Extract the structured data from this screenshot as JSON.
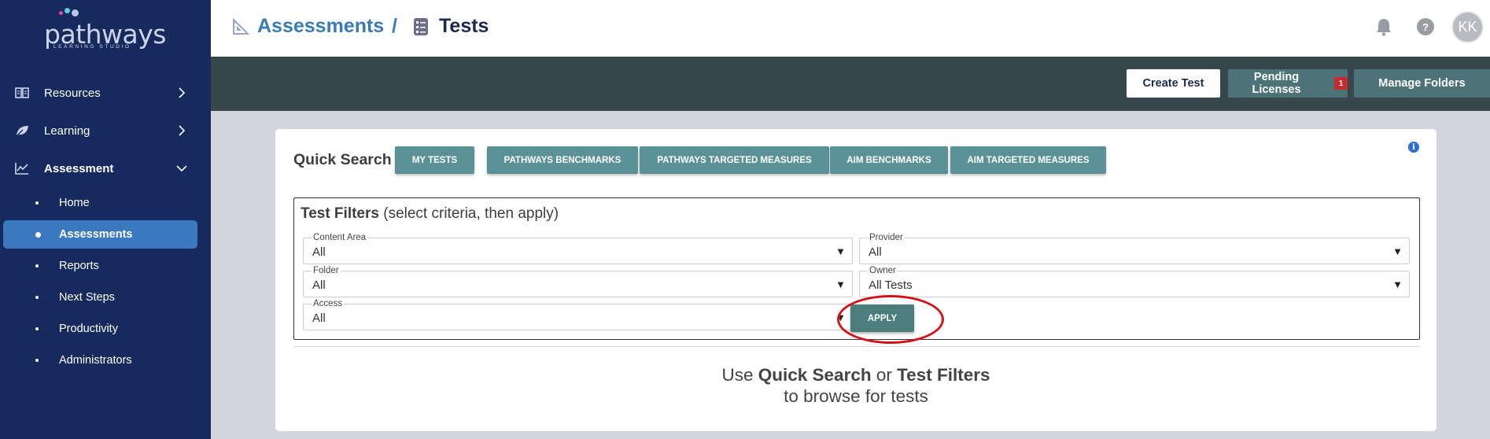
{
  "logo": {
    "word": "pathways",
    "sub": "LEARNING STUDIO"
  },
  "sidebar": {
    "items": [
      {
        "label": "Resources",
        "icon": "book-icon"
      },
      {
        "label": "Learning",
        "icon": "leaf-icon"
      },
      {
        "label": "Assessment",
        "icon": "chart-icon"
      }
    ],
    "sub_items": [
      {
        "label": "Home"
      },
      {
        "label": "Assessments",
        "active": true
      },
      {
        "label": "Reports"
      },
      {
        "label": "Next Steps"
      },
      {
        "label": "Productivity"
      },
      {
        "label": "Administrators"
      }
    ]
  },
  "header": {
    "breadcrumb_1": "Assessments",
    "separator": "/",
    "breadcrumb_2": "Tests",
    "help": "?",
    "avatar": "KK"
  },
  "toolbar": {
    "create_label": "Create Test",
    "pending_label": "Pending Licenses",
    "pending_count": "1",
    "manage_label": "Manage Folders"
  },
  "quick_search": {
    "label": "Quick Search",
    "buttons": [
      "MY TESTS",
      "PATHWAYS BENCHMARKS",
      "PATHWAYS TARGETED MEASURES",
      "AIM BENCHMARKS",
      "AIM TARGETED MEASURES"
    ],
    "info": "i"
  },
  "filters": {
    "title_bold": "Test Filters",
    "title_rest": " (select criteria, then apply)",
    "content_area": {
      "label": "Content Area",
      "value": "All"
    },
    "provider": {
      "label": "Provider",
      "value": "All"
    },
    "folder": {
      "label": "Folder",
      "value": "All"
    },
    "owner": {
      "label": "Owner",
      "value": "All Tests"
    },
    "access": {
      "label": "Access",
      "value": "All"
    },
    "apply_label": "APPLY",
    "arrow": "▼"
  },
  "hint": {
    "use": "Use ",
    "quick": "Quick Search",
    "or": " or ",
    "filters": "Test Filters",
    "line2": "to browse for tests"
  },
  "colors": {
    "sidebar_bg": "#172a5e",
    "active_item": "#3b78bd",
    "toolbar_bg": "#38474e",
    "teal_button": "#5b9297",
    "badge_red": "#c52b2f",
    "highlight_ring": "#d3131b"
  }
}
